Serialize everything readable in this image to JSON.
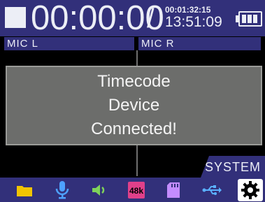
{
  "status": {
    "counter": "00:00:00",
    "separator": "/",
    "timecode": "00:01:32:15",
    "clock": "13:51:09",
    "battery_level": 1.0
  },
  "channels": {
    "left": "MIC L",
    "right": "MIC R"
  },
  "dialog": {
    "line1": "Timecode",
    "line2": "Device",
    "line3": "Connected!"
  },
  "menu": {
    "active_tab": "SYSTEM"
  },
  "toolbar": {
    "icons": [
      "folder-icon",
      "microphone-icon",
      "speaker-icon",
      "sample-rate-icon",
      "sd-card-icon",
      "usb-icon",
      "gear-icon"
    ],
    "sample_rate_label": "48k",
    "colors": {
      "folder": "#f1c400",
      "microphone": "#4ea1ff",
      "speaker": "#7fd35a",
      "sample_rate": "#e0408a",
      "sd_card": "#c48cff",
      "usb": "#5ab0ff",
      "gear": "#000000"
    }
  }
}
